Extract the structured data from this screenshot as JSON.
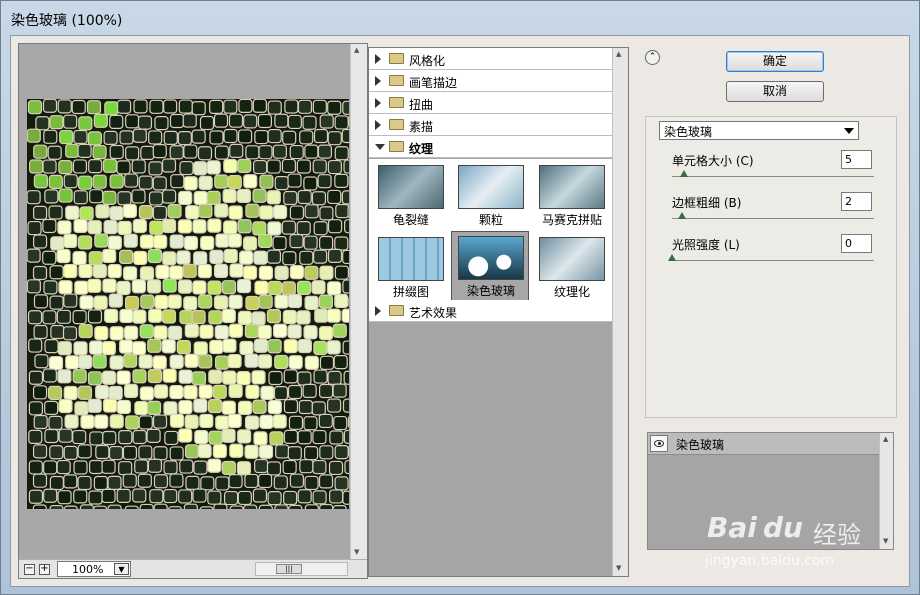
{
  "window": {
    "title": "染色玻璃 (100%)"
  },
  "preview": {
    "zoom": "100%",
    "zoom_out": "−",
    "zoom_in": "+",
    "zoom_dropdown_glyph": "▼",
    "scroll_thumb_glyph": "|||"
  },
  "gallery": {
    "categories": [
      {
        "label": "风格化",
        "expanded": false
      },
      {
        "label": "画笔描边",
        "expanded": false
      },
      {
        "label": "扭曲",
        "expanded": false
      },
      {
        "label": "素描",
        "expanded": false
      },
      {
        "label": "纹理",
        "expanded": true
      },
      {
        "label": "艺术效果",
        "expanded": false
      }
    ],
    "texture_filters": [
      {
        "label": "龟裂缝"
      },
      {
        "label": "颗粒"
      },
      {
        "label": "马赛克拼贴"
      },
      {
        "label": "拼缀图"
      },
      {
        "label": "染色玻璃",
        "selected": true
      },
      {
        "label": "纹理化"
      }
    ]
  },
  "actions": {
    "collapse_glyph": "⌃",
    "ok_label": "确定",
    "cancel_label": "取消"
  },
  "settings": {
    "filter": "染色玻璃",
    "params": [
      {
        "label": "单元格大小 (C)",
        "value": "5",
        "fraction": 0.06
      },
      {
        "label": "边框粗细 (B)",
        "value": "2",
        "fraction": 0.05
      },
      {
        "label": "光照强度 (L)",
        "value": "0",
        "fraction": 0.0
      }
    ]
  },
  "layers": {
    "items": [
      {
        "name": "染色玻璃",
        "visible": true
      }
    ]
  },
  "watermark": {
    "brand": "Bai",
    "brand_paw": "du",
    "product": "经验",
    "url": "jingyan.baidu.com"
  },
  "colors": {
    "accent": "#3b7bbf",
    "panel": "#ece9e4",
    "gallery_bg": "#a5a5a5"
  }
}
